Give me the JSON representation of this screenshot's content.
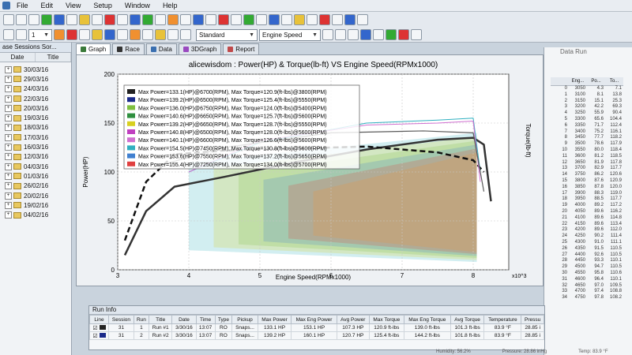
{
  "menu": {
    "items": [
      "File",
      "Edit",
      "View",
      "Setup",
      "Window",
      "Help"
    ]
  },
  "toolbar": {
    "profile": "Standard",
    "xaxis": "Engine Speed",
    "index": "1"
  },
  "sessions": {
    "title": "ase Sessions Sor...",
    "columns": [
      "Date",
      "Title"
    ],
    "items": [
      "30/03/16",
      "29/03/16",
      "24/03/16",
      "22/03/16",
      "20/03/16",
      "19/03/16",
      "18/03/16",
      "17/03/16",
      "16/03/16",
      "12/03/16",
      "04/03/16",
      "01/03/16",
      "26/02/16",
      "20/02/16",
      "19/02/16",
      "04/02/16"
    ]
  },
  "tabs": [
    {
      "label": "Graph",
      "color": "#3a7a3a"
    },
    {
      "label": "Race",
      "color": "#333333"
    },
    {
      "label": "Data",
      "color": "#3a6fb0"
    },
    {
      "label": "3DGraph",
      "color": "#9a4ac0"
    },
    {
      "label": "Report",
      "color": "#c04a4a"
    }
  ],
  "chart_data": {
    "type": "line",
    "title": "alicewisdom : Power(HP) & Torque(lb-ft) VS Engine Speed(RPMx1000)",
    "xlabel": "Engine Speed(RPMx1000)",
    "ylabel": "Power(HP)",
    "y2label": "Torque(lb-ft)",
    "xlim": [
      3,
      8.5
    ],
    "ylim": [
      0,
      200
    ],
    "xticks": [
      "3",
      "4",
      "5",
      "6",
      "7",
      "8"
    ],
    "yticks": [
      "0",
      "50",
      "100",
      "150",
      "200"
    ],
    "x_multiplier": "x10^3",
    "grid": true,
    "legend": [
      {
        "label": "Max Power=133.1(HP)@6700(RPM), Max Torque=120.9(ft-lbs)@3800(RPM)",
        "color": "#222222"
      },
      {
        "label": "Max Power=139.2(HP)@6500(RPM), Max Torque=125.4(ft-lbs)@5550(RPM)",
        "color": "#1a2a8a"
      },
      {
        "label": "Max Power=136.0(HP)@6750(RPM), Max Torque=124.0(ft-lbs)@5400(RPM)",
        "color": "#7fbf3f"
      },
      {
        "label": "Max Power=140.6(HP)@6650(RPM), Max Torque=125.7(ft-lbs)@5600(RPM)",
        "color": "#2f8f3f"
      },
      {
        "label": "Max Power=139.2(HP)@6650(RPM), Max Torque=128.7(ft-lbs)@5550(RPM)",
        "color": "#d8d020"
      },
      {
        "label": "Max Power=140.8(HP)@6500(RPM), Max Torque=128.0(ft-lbs)@5600(RPM)",
        "color": "#c040c0"
      },
      {
        "label": "Max Power=140.1(HP)@6600(RPM), Max Torque=126.6(ft-lbs)@5600(RPM)",
        "color": "#d070d0"
      },
      {
        "label": "Max Power=154.5(HP)@7450(RPM), Max Torque=130.8(ft-lbs)@5600(RPM)",
        "color": "#30b0c0"
      },
      {
        "label": "Max Power=153.6(HP)@7550(RPM), Max Torque=137.2(ft-lbs)@5650(RPM)",
        "color": "#4080d0"
      },
      {
        "label": "Max Power=155.4(HP)@7250(RPM), Max Torque=134.0(ft-lbs)@5700(RPM)",
        "color": "#e04040"
      }
    ],
    "series": [
      {
        "x": [
          3.1,
          3.4,
          3.8,
          4.5,
          5.5,
          6.5,
          7.5,
          8.0,
          8.15,
          8.25
        ],
        "values": [
          15,
          60,
          85,
          95,
          110,
          123,
          133,
          135,
          128,
          70
        ],
        "color": "#333333",
        "width": 2.5,
        "dash": false
      },
      {
        "x": [
          3.1,
          3.4,
          3.8,
          4.5,
          5.5,
          6.5,
          7.5,
          8.0,
          8.15
        ],
        "values": [
          30,
          90,
          118,
          122,
          124,
          126,
          120,
          112,
          100
        ],
        "color": "#111111",
        "width": 2.5,
        "dash": true
      },
      {
        "x": [
          4.0,
          5.0,
          6.5,
          7.5,
          8.0,
          8.1
        ],
        "values": [
          100,
          130,
          150,
          153,
          155,
          100
        ],
        "color": "#30b0c0",
        "width": 1,
        "dash": false
      },
      {
        "x": [
          4.0,
          5.0,
          6.5,
          7.5,
          8.0,
          8.1
        ],
        "values": [
          100,
          132,
          148,
          150,
          152,
          90
        ],
        "color": "#d070d0",
        "width": 1,
        "dash": false
      },
      {
        "x": [
          3.5,
          4.5,
          6.0,
          7.3,
          8.0,
          8.15
        ],
        "values": [
          105,
          125,
          140,
          142,
          140,
          80
        ],
        "color": "#5a5a5a",
        "width": 1.2,
        "dash": false
      }
    ]
  },
  "runinfo": {
    "title": "Run Info",
    "columns": [
      "Line",
      "Session",
      "Run",
      "Title",
      "Date",
      "Time",
      "Type",
      "Pickup",
      "Max Power",
      "Max Eng Power",
      "Avg Power",
      "Max Torque",
      "Max Eng Torque",
      "Avg Torque",
      "Temperature",
      "Pressu"
    ],
    "rows": [
      {
        "session": "31",
        "run": "1",
        "title": "Run #1",
        "date": "3/30/16",
        "time": "13:07",
        "type": "RO",
        "pickup": "Snaps...",
        "max_power": "133.1 HP",
        "max_eng_power": "153.1 HP",
        "avg_power": "107.3 HP",
        "max_torque": "120.9 ft-lbs",
        "max_eng_torque": "139.0 ft-lbs",
        "avg_torque": "101.3 ft-lbs",
        "temperature": "83.9 °F",
        "pressure": "28.85 i"
      },
      {
        "session": "31",
        "run": "2",
        "title": "Run #2",
        "date": "3/30/16",
        "time": "13:07",
        "type": "RO",
        "pickup": "Snaps...",
        "max_power": "139.2 HP",
        "max_eng_power": "160.1 HP",
        "avg_power": "120.7 HP",
        "max_torque": "125.4 ft-lbs",
        "max_eng_torque": "144.2 ft-lbs",
        "avg_torque": "101.8 ft-lbs",
        "temperature": "83.9 °F",
        "pressure": "28.85 i"
      }
    ]
  },
  "status": {
    "humidity": "Humidity: 56.2%",
    "pressure": "Pressure: 28.86 inHg",
    "temp": "Temp: 83.9 °F"
  },
  "datapanel": {
    "title": "Data Run",
    "columns": [
      "",
      "Eng...",
      "Po...",
      "To..."
    ],
    "rows": [
      [
        "0",
        "3050",
        "4.3",
        "7.1"
      ],
      [
        "1",
        "3100",
        "8.1",
        "13.8"
      ],
      [
        "2",
        "3150",
        "15.1",
        "25.3"
      ],
      [
        "3",
        "3200",
        "42.2",
        "69.3"
      ],
      [
        "4",
        "3250",
        "55.9",
        "90.4"
      ],
      [
        "5",
        "3300",
        "65.6",
        "104.4"
      ],
      [
        "6",
        "3350",
        "71.7",
        "112.4"
      ],
      [
        "7",
        "3400",
        "75.2",
        "116.1"
      ],
      [
        "8",
        "3450",
        "77.7",
        "118.2"
      ],
      [
        "9",
        "3500",
        "78.6",
        "117.9"
      ],
      [
        "10",
        "3550",
        "80.0",
        "118.4"
      ],
      [
        "11",
        "3600",
        "81.2",
        "118.5"
      ],
      [
        "12",
        "3650",
        "81.9",
        "117.8"
      ],
      [
        "13",
        "3700",
        "82.9",
        "117.7"
      ],
      [
        "14",
        "3750",
        "86.2",
        "120.6"
      ],
      [
        "15",
        "3800",
        "87.6",
        "120.9"
      ],
      [
        "16",
        "3850",
        "87.8",
        "120.0"
      ],
      [
        "17",
        "3900",
        "88.3",
        "119.0"
      ],
      [
        "18",
        "3950",
        "88.5",
        "117.7"
      ],
      [
        "19",
        "4000",
        "89.2",
        "117.2"
      ],
      [
        "20",
        "4050",
        "89.6",
        "116.2"
      ],
      [
        "21",
        "4100",
        "89.6",
        "114.8"
      ],
      [
        "22",
        "4150",
        "89.6",
        "113.4"
      ],
      [
        "23",
        "4200",
        "89.6",
        "112.0"
      ],
      [
        "24",
        "4250",
        "90.2",
        "111.4"
      ],
      [
        "25",
        "4300",
        "91.0",
        "111.1"
      ],
      [
        "26",
        "4350",
        "91.5",
        "110.5"
      ],
      [
        "27",
        "4400",
        "92.6",
        "110.5"
      ],
      [
        "28",
        "4450",
        "93.3",
        "110.1"
      ],
      [
        "29",
        "4500",
        "94.7",
        "110.5"
      ],
      [
        "30",
        "4550",
        "95.8",
        "110.6"
      ],
      [
        "31",
        "4600",
        "96.4",
        "110.1"
      ],
      [
        "32",
        "4650",
        "97.0",
        "109.5"
      ],
      [
        "33",
        "4700",
        "97.4",
        "108.8"
      ],
      [
        "34",
        "4750",
        "97.8",
        "108.2"
      ]
    ]
  }
}
